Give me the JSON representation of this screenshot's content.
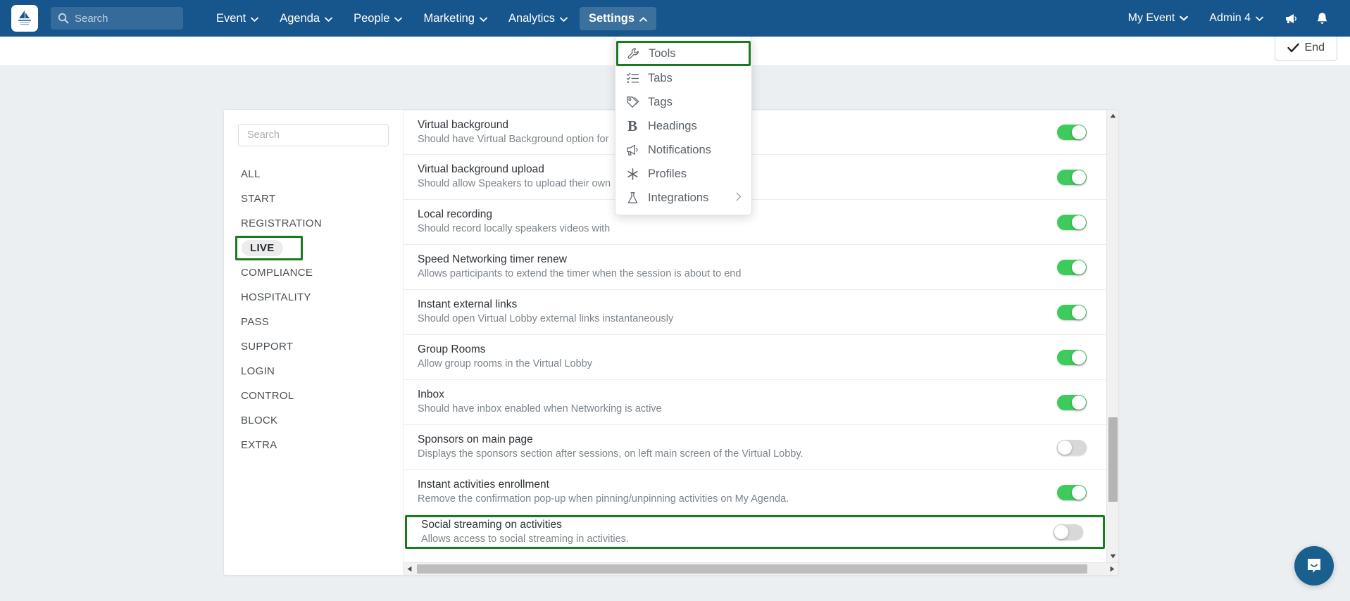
{
  "navbar": {
    "logo_alt": "event-logo",
    "search_placeholder": "Search",
    "search_value": "",
    "items": [
      {
        "label": "Event",
        "has_caret": true,
        "active": false
      },
      {
        "label": "Agenda",
        "has_caret": true,
        "active": false
      },
      {
        "label": "People",
        "has_caret": true,
        "active": false
      },
      {
        "label": "Marketing",
        "has_caret": true,
        "active": false
      },
      {
        "label": "Analytics",
        "has_caret": true,
        "active": false
      },
      {
        "label": "Settings",
        "has_caret": true,
        "active": true
      }
    ],
    "right": {
      "event_label": "My Event",
      "admin_label": "Admin 4",
      "megaphone_icon": "megaphone-icon",
      "bell_icon": "bell-icon"
    }
  },
  "subheader": {
    "end_button": "End"
  },
  "dropdown": {
    "items": [
      {
        "label": "Tools",
        "icon": "wrench-icon",
        "highlighted": true,
        "submenu": false
      },
      {
        "label": "Tabs",
        "icon": "checklist-icon",
        "highlighted": false,
        "submenu": false
      },
      {
        "label": "Tags",
        "icon": "tag-icon",
        "highlighted": false,
        "submenu": false
      },
      {
        "label": "Headings",
        "icon": "bold-b-icon",
        "highlighted": false,
        "submenu": false
      },
      {
        "label": "Notifications",
        "icon": "megaphone-icon",
        "highlighted": false,
        "submenu": false
      },
      {
        "label": "Profiles",
        "icon": "asterisk-icon",
        "highlighted": false,
        "submenu": false
      },
      {
        "label": "Integrations",
        "icon": "flask-icon",
        "highlighted": false,
        "submenu": true
      }
    ]
  },
  "sidebar": {
    "search_placeholder": "Search",
    "search_value": "",
    "items": [
      {
        "label": "ALL",
        "selected": false
      },
      {
        "label": "START",
        "selected": false
      },
      {
        "label": "REGISTRATION",
        "selected": false
      },
      {
        "label": "LIVE",
        "selected": true
      },
      {
        "label": "COMPLIANCE",
        "selected": false
      },
      {
        "label": "HOSPITALITY",
        "selected": false
      },
      {
        "label": "PASS",
        "selected": false
      },
      {
        "label": "SUPPORT",
        "selected": false
      },
      {
        "label": "LOGIN",
        "selected": false
      },
      {
        "label": "CONTROL",
        "selected": false
      },
      {
        "label": "BLOCK",
        "selected": false
      },
      {
        "label": "EXTRA",
        "selected": false
      }
    ]
  },
  "settings": {
    "rows": [
      {
        "title": "Virtual background",
        "description": "Should have Virtual Background option for",
        "toggle": "on",
        "highlighted": false
      },
      {
        "title": "Virtual background upload",
        "description": "Should allow Speakers to upload their own",
        "toggle": "on",
        "highlighted": false
      },
      {
        "title": "Local recording",
        "description": "Should record locally speakers videos with",
        "toggle": "on",
        "highlighted": false
      },
      {
        "title": "Speed Networking timer renew",
        "description": "Allows participants to extend the timer when the session is about to end",
        "toggle": "on",
        "highlighted": false
      },
      {
        "title": "Instant external links",
        "description": "Should open Virtual Lobby external links instantaneously",
        "toggle": "on",
        "highlighted": false
      },
      {
        "title": "Group Rooms",
        "description": "Allow group rooms in the Virtual Lobby",
        "toggle": "on",
        "highlighted": false
      },
      {
        "title": "Inbox",
        "description": "Should have inbox enabled when Networking is active",
        "toggle": "on",
        "highlighted": false
      },
      {
        "title": "Sponsors on main page",
        "description": "Displays the sponsors section after sessions, on left main screen of the Virtual Lobby.",
        "toggle": "off",
        "highlighted": false
      },
      {
        "title": "Instant activities enrollment",
        "description": "Remove the confirmation pop-up when pinning/unpinning activities on My Agenda.",
        "toggle": "on",
        "highlighted": false
      },
      {
        "title": "Social streaming on activities",
        "description": "Allows access to social streaming in activities.",
        "toggle": "off",
        "highlighted": true
      }
    ]
  },
  "scrollbars": {
    "vertical_up": "scroll-up-arrow",
    "vertical_down": "scroll-down-arrow",
    "horizontal_left": "scroll-left-arrow",
    "horizontal_right": "scroll-right-arrow"
  },
  "chat": {
    "icon": "chat-bubble-icon"
  },
  "colors": {
    "navbar_blue": "#17568c",
    "toggle_on_green": "#3fcb5c",
    "toggle_off_gray": "#d6d8da",
    "highlight_green": "#1a7a1f",
    "page_bg": "#eceff1"
  }
}
